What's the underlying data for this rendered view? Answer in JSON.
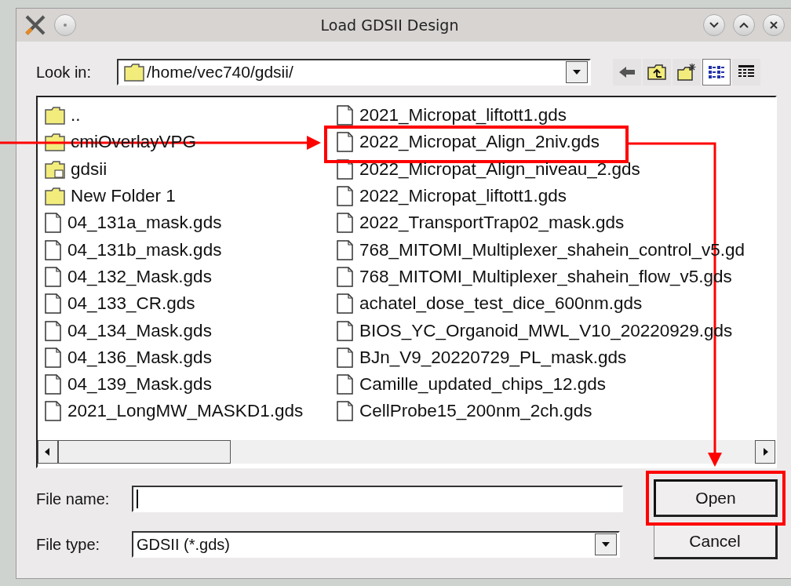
{
  "window": {
    "title": "Load GDSII Design"
  },
  "look_in": {
    "label": "Look in:",
    "path": "/home/vec740/gdsii/"
  },
  "view_buttons": [
    {
      "kind": "list",
      "selected": true
    },
    {
      "kind": "detail",
      "selected": false
    }
  ],
  "files": [
    {
      "kind": "folder",
      "name": ".."
    },
    {
      "kind": "folder",
      "name": "cmiOverlayVPG"
    },
    {
      "kind": "link-folder",
      "name": "gdsii"
    },
    {
      "kind": "folder",
      "name": "New Folder 1"
    },
    {
      "kind": "file",
      "name": "04_131a_mask.gds"
    },
    {
      "kind": "file",
      "name": "04_131b_mask.gds"
    },
    {
      "kind": "file",
      "name": "04_132_Mask.gds"
    },
    {
      "kind": "file",
      "name": "04_133_CR.gds"
    },
    {
      "kind": "file",
      "name": "04_134_Mask.gds"
    },
    {
      "kind": "file",
      "name": "04_136_Mask.gds"
    },
    {
      "kind": "file",
      "name": "04_139_Mask.gds"
    },
    {
      "kind": "file",
      "name": "2021_LongMW_MASKD1.gds"
    },
    {
      "kind": "file",
      "name": "2021_Micropat_liftott1.gds"
    },
    {
      "kind": "file",
      "name": "2022_Micropat_Align_2niv.gds"
    },
    {
      "kind": "file",
      "name": "2022_Micropat_Align_niveau_2.gds"
    },
    {
      "kind": "file",
      "name": "2022_Micropat_liftott1.gds"
    },
    {
      "kind": "file",
      "name": "2022_TransportTrap02_mask.gds"
    },
    {
      "kind": "file",
      "name": "768_MITOMI_Multiplexer_shahein_control_v5.gd"
    },
    {
      "kind": "file",
      "name": "768_MITOMI_Multiplexer_shahein_flow_v5.gds"
    },
    {
      "kind": "file",
      "name": "achatel_dose_test_dice_600nm.gds"
    },
    {
      "kind": "file",
      "name": "BIOS_YC_Organoid_MWL_V10_20220929.gds"
    },
    {
      "kind": "file",
      "name": "BJn_V9_20220729_PL_mask.gds"
    },
    {
      "kind": "file",
      "name": "Camille_updated_chips_12.gds"
    },
    {
      "kind": "file",
      "name": "CellProbe15_200nm_2ch.gds"
    }
  ],
  "file_name": {
    "label": "File name:"
  },
  "file_type": {
    "label": "File type:",
    "value": "GDSII (*.gds)"
  },
  "buttons": [
    "Open",
    "Cancel"
  ]
}
